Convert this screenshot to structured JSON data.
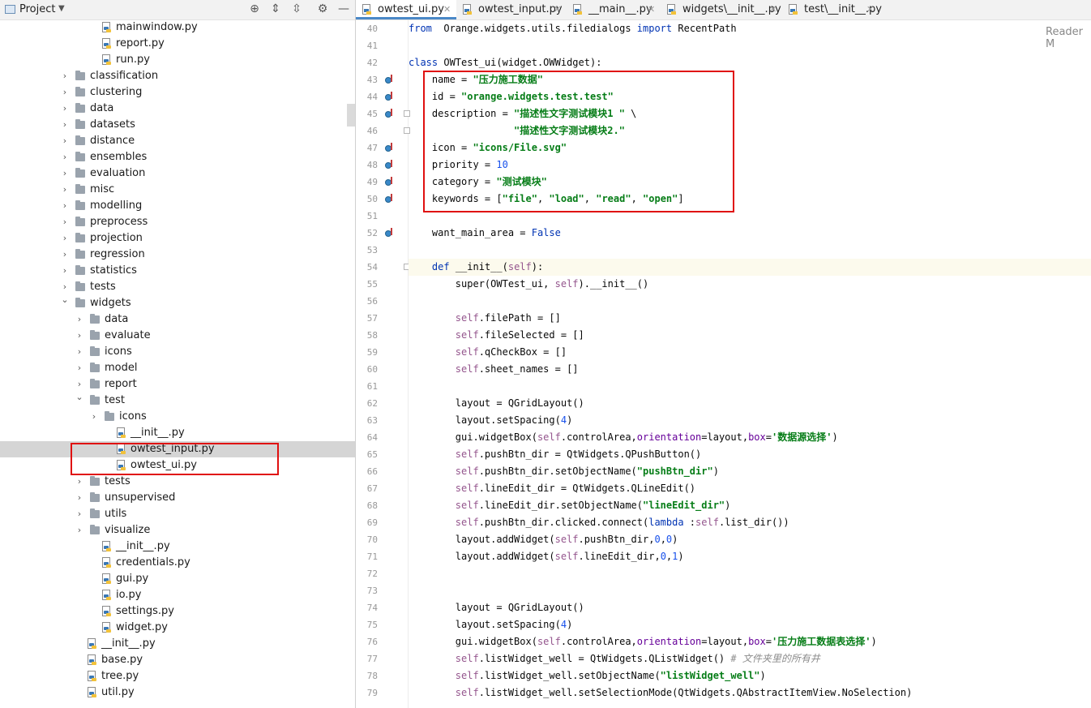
{
  "project_panel": {
    "title": "Project",
    "tree": [
      {
        "label": "mainwindow.py",
        "type": "py",
        "indent": 5,
        "arrow": ""
      },
      {
        "label": "report.py",
        "type": "py",
        "indent": 5,
        "arrow": ""
      },
      {
        "label": "run.py",
        "type": "py",
        "indent": 5,
        "arrow": ""
      },
      {
        "label": "classification",
        "type": "folder",
        "indent": 3,
        "arrow": ">"
      },
      {
        "label": "clustering",
        "type": "folder",
        "indent": 3,
        "arrow": ">"
      },
      {
        "label": "data",
        "type": "folder",
        "indent": 3,
        "arrow": ">"
      },
      {
        "label": "datasets",
        "type": "folder",
        "indent": 3,
        "arrow": ">"
      },
      {
        "label": "distance",
        "type": "folder",
        "indent": 3,
        "arrow": ">"
      },
      {
        "label": "ensembles",
        "type": "folder",
        "indent": 3,
        "arrow": ">"
      },
      {
        "label": "evaluation",
        "type": "folder",
        "indent": 3,
        "arrow": ">"
      },
      {
        "label": "misc",
        "type": "folder",
        "indent": 3,
        "arrow": ">"
      },
      {
        "label": "modelling",
        "type": "folder",
        "indent": 3,
        "arrow": ">"
      },
      {
        "label": "preprocess",
        "type": "folder",
        "indent": 3,
        "arrow": ">"
      },
      {
        "label": "projection",
        "type": "folder",
        "indent": 3,
        "arrow": ">"
      },
      {
        "label": "regression",
        "type": "folder",
        "indent": 3,
        "arrow": ">"
      },
      {
        "label": "statistics",
        "type": "folder",
        "indent": 3,
        "arrow": ">"
      },
      {
        "label": "tests",
        "type": "folder",
        "indent": 3,
        "arrow": ">"
      },
      {
        "label": "widgets",
        "type": "folder",
        "indent": 3,
        "arrow": "v"
      },
      {
        "label": "data",
        "type": "folder",
        "indent": 4,
        "arrow": ">"
      },
      {
        "label": "evaluate",
        "type": "folder",
        "indent": 4,
        "arrow": ">"
      },
      {
        "label": "icons",
        "type": "folder",
        "indent": 4,
        "arrow": ">"
      },
      {
        "label": "model",
        "type": "folder",
        "indent": 4,
        "arrow": ">"
      },
      {
        "label": "report",
        "type": "folder",
        "indent": 4,
        "arrow": ">"
      },
      {
        "label": "test",
        "type": "folder",
        "indent": 4,
        "arrow": "v"
      },
      {
        "label": "icons",
        "type": "folder",
        "indent": 5,
        "arrow": ">"
      },
      {
        "label": "__init__.py",
        "type": "py",
        "indent": 6,
        "arrow": ""
      },
      {
        "label": "owtest_input.py",
        "type": "py",
        "indent": 6,
        "arrow": "",
        "selected": true
      },
      {
        "label": "owtest_ui.py",
        "type": "py",
        "indent": 6,
        "arrow": ""
      },
      {
        "label": "tests",
        "type": "folder",
        "indent": 4,
        "arrow": ">"
      },
      {
        "label": "unsupervised",
        "type": "folder",
        "indent": 4,
        "arrow": ">"
      },
      {
        "label": "utils",
        "type": "folder",
        "indent": 4,
        "arrow": ">"
      },
      {
        "label": "visualize",
        "type": "folder",
        "indent": 4,
        "arrow": ">"
      },
      {
        "label": "__init__.py",
        "type": "py",
        "indent": 5,
        "arrow": ""
      },
      {
        "label": "credentials.py",
        "type": "py",
        "indent": 5,
        "arrow": ""
      },
      {
        "label": "gui.py",
        "type": "py",
        "indent": 5,
        "arrow": ""
      },
      {
        "label": "io.py",
        "type": "py",
        "indent": 5,
        "arrow": ""
      },
      {
        "label": "settings.py",
        "type": "py",
        "indent": 5,
        "arrow": ""
      },
      {
        "label": "widget.py",
        "type": "py",
        "indent": 5,
        "arrow": ""
      },
      {
        "label": "__init__.py",
        "type": "py",
        "indent": 4,
        "arrow": ""
      },
      {
        "label": "base.py",
        "type": "py",
        "indent": 4,
        "arrow": ""
      },
      {
        "label": "tree.py",
        "type": "py",
        "indent": 4,
        "arrow": ""
      },
      {
        "label": "util.py",
        "type": "py",
        "indent": 4,
        "arrow": ""
      }
    ]
  },
  "tabs": [
    {
      "label": "owtest_ui.py",
      "active": true
    },
    {
      "label": "owtest_input.py",
      "active": false
    },
    {
      "label": "__main__.py",
      "active": false
    },
    {
      "label": "widgets\\__init__.py",
      "active": false
    },
    {
      "label": "test\\__init__.py",
      "active": false
    }
  ],
  "reader_mode_label": "Reader M",
  "code": {
    "first_line": 40,
    "lines": [
      [
        [
          "kw",
          "from"
        ],
        [
          "",
          "  Orange.widgets.utils.filedialogs "
        ],
        [
          "kw",
          "import"
        ],
        [
          "",
          " RecentPath"
        ]
      ],
      [],
      [
        [
          "kw",
          "class"
        ],
        [
          "",
          " OWTest_ui(widget.OWWidget):"
        ]
      ],
      [
        [
          "",
          "    name = "
        ],
        [
          "st",
          "\"压力施工数据\""
        ]
      ],
      [
        [
          "",
          "    id = "
        ],
        [
          "st",
          "\"orange.widgets.test.test\""
        ]
      ],
      [
        [
          "",
          "    description = "
        ],
        [
          "st",
          "\"描述性文字测试模块1 \""
        ],
        [
          "",
          " \\"
        ]
      ],
      [
        [
          "",
          "                  "
        ],
        [
          "st",
          "\"描述性文字测试模块2.\""
        ]
      ],
      [
        [
          "",
          "    icon = "
        ],
        [
          "st",
          "\"icons/File.svg\""
        ]
      ],
      [
        [
          "",
          "    priority = "
        ],
        [
          "nm",
          "10"
        ]
      ],
      [
        [
          "",
          "    category = "
        ],
        [
          "st",
          "\"测试模块\""
        ]
      ],
      [
        [
          "",
          "    keywords = ["
        ],
        [
          "st",
          "\"file\""
        ],
        [
          "",
          ", "
        ],
        [
          "st",
          "\"load\""
        ],
        [
          "",
          ", "
        ],
        [
          "st",
          "\"read\""
        ],
        [
          "",
          ", "
        ],
        [
          "st",
          "\"open\""
        ],
        [
          "",
          "]"
        ]
      ],
      [],
      [
        [
          "",
          "    want_main_area = "
        ],
        [
          "kw",
          "False"
        ]
      ],
      [],
      [
        [
          "",
          "    "
        ],
        [
          "kw",
          "def"
        ],
        [
          "",
          " __init__("
        ],
        [
          "sf",
          "self"
        ],
        [
          "",
          "):"
        ]
      ],
      [
        [
          "",
          "        super(OWTest_ui, "
        ],
        [
          "sf",
          "self"
        ],
        [
          "",
          ").__init__()"
        ]
      ],
      [],
      [
        [
          "",
          "        "
        ],
        [
          "sf",
          "self"
        ],
        [
          "",
          ".filePath = []"
        ]
      ],
      [
        [
          "",
          "        "
        ],
        [
          "sf",
          "self"
        ],
        [
          "",
          ".fileSelected = []"
        ]
      ],
      [
        [
          "",
          "        "
        ],
        [
          "sf",
          "self"
        ],
        [
          "",
          ".qCheckBox = []"
        ]
      ],
      [
        [
          "",
          "        "
        ],
        [
          "sf",
          "self"
        ],
        [
          "",
          ".sheet_names = []"
        ]
      ],
      [],
      [
        [
          "",
          "        layout = QGridLayout()"
        ]
      ],
      [
        [
          "",
          "        layout.setSpacing("
        ],
        [
          "nm",
          "4"
        ],
        [
          "",
          ")"
        ]
      ],
      [
        [
          "",
          "        gui.widgetBox("
        ],
        [
          "sf",
          "self"
        ],
        [
          "",
          ".controlArea,"
        ],
        [
          "pa",
          "orientation"
        ],
        [
          "",
          "=layout,"
        ],
        [
          "pa",
          "box"
        ],
        [
          "",
          "="
        ],
        [
          "st",
          "'数据源选择'"
        ],
        [
          "",
          ")"
        ]
      ],
      [
        [
          "",
          "        "
        ],
        [
          "sf",
          "self"
        ],
        [
          "",
          ".pushBtn_dir = QtWidgets.QPushButton()"
        ]
      ],
      [
        [
          "",
          "        "
        ],
        [
          "sf",
          "self"
        ],
        [
          "",
          ".pushBtn_dir.setObjectName("
        ],
        [
          "st",
          "\"pushBtn_dir\""
        ],
        [
          "",
          ")"
        ]
      ],
      [
        [
          "",
          "        "
        ],
        [
          "sf",
          "self"
        ],
        [
          "",
          ".lineEdit_dir = QtWidgets.QLineEdit()"
        ]
      ],
      [
        [
          "",
          "        "
        ],
        [
          "sf",
          "self"
        ],
        [
          "",
          ".lineEdit_dir.setObjectName("
        ],
        [
          "st",
          "\"lineEdit_dir\""
        ],
        [
          "",
          ")"
        ]
      ],
      [
        [
          "",
          "        "
        ],
        [
          "sf",
          "self"
        ],
        [
          "",
          ".pushBtn_dir.clicked.connect("
        ],
        [
          "kw",
          "lambda"
        ],
        [
          "",
          " :"
        ],
        [
          "sf",
          "self"
        ],
        [
          "",
          ".list_dir())"
        ]
      ],
      [
        [
          "",
          "        layout.addWidget("
        ],
        [
          "sf",
          "self"
        ],
        [
          "",
          ".pushBtn_dir,"
        ],
        [
          "nm",
          "0"
        ],
        [
          "",
          ","
        ],
        [
          "nm",
          "0"
        ],
        [
          "",
          ")"
        ]
      ],
      [
        [
          "",
          "        layout.addWidget("
        ],
        [
          "sf",
          "self"
        ],
        [
          "",
          ".lineEdit_dir,"
        ],
        [
          "nm",
          "0"
        ],
        [
          "",
          ","
        ],
        [
          "nm",
          "1"
        ],
        [
          "",
          ")"
        ]
      ],
      [],
      [],
      [
        [
          "",
          "        layout = QGridLayout()"
        ]
      ],
      [
        [
          "",
          "        layout.setSpacing("
        ],
        [
          "nm",
          "4"
        ],
        [
          "",
          ")"
        ]
      ],
      [
        [
          "",
          "        gui.widgetBox("
        ],
        [
          "sf",
          "self"
        ],
        [
          "",
          ".controlArea,"
        ],
        [
          "pa",
          "orientation"
        ],
        [
          "",
          "=layout,"
        ],
        [
          "pa",
          "box"
        ],
        [
          "",
          "="
        ],
        [
          "st",
          "'压力施工数据表选择'"
        ],
        [
          "",
          ")"
        ]
      ],
      [
        [
          "",
          "        "
        ],
        [
          "sf",
          "self"
        ],
        [
          "",
          ".listWidget_well = QtWidgets.QListWidget() "
        ],
        [
          "cm",
          "# 文件夹里的所有井"
        ]
      ],
      [
        [
          "",
          "        "
        ],
        [
          "sf",
          "self"
        ],
        [
          "",
          ".listWidget_well.setObjectName("
        ],
        [
          "st",
          "\"listWidget_well\""
        ],
        [
          "",
          ")"
        ]
      ],
      [
        [
          "",
          "        "
        ],
        [
          "sf",
          "self"
        ],
        [
          "",
          ".listWidget_well.setSelectionMode(QtWidgets.QAbstractItemView.NoSelection)"
        ]
      ]
    ],
    "gutter_marks": [
      43,
      44,
      45,
      47,
      48,
      49,
      50,
      52
    ],
    "fold_marks": [
      45,
      46,
      54
    ],
    "highlighted_line": 54
  },
  "colors": {
    "selection": "#d5d5d5",
    "highlight_box": "#e01010",
    "keyword": "#0033b3",
    "string": "#067d17"
  }
}
